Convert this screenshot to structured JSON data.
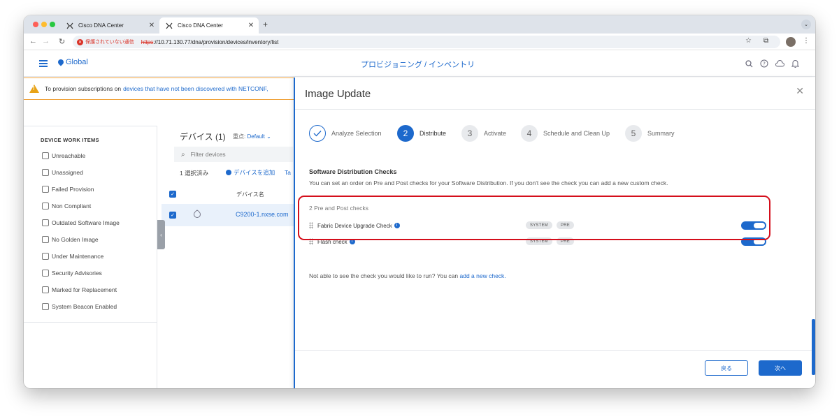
{
  "browser": {
    "tabs": [
      {
        "title": "Cisco DNA Center",
        "active": false
      },
      {
        "title": "Cisco DNA Center",
        "active": true
      }
    ],
    "new_tab": "+",
    "security_label": "保護されていない通信",
    "url_scheme": "https",
    "url_rest": "://10.71.130.77/dna/provision/devices/inventory/list"
  },
  "header": {
    "global_label": "Global",
    "title": "プロビジョニング / インベントリ"
  },
  "alert": {
    "text_before": "To provision subscriptions on",
    "link": "devices that have not been discovered with NETCONF,"
  },
  "work_items": {
    "title": "DEVICE WORK ITEMS",
    "items": [
      "Unreachable",
      "Unassigned",
      "Failed Provision",
      "Non Compliant",
      "Outdated Software Image",
      "No Golden Image",
      "Under Maintenance",
      "Security Advisories",
      "Marked for Replacement",
      "System Beacon Enabled"
    ]
  },
  "devices": {
    "title": "デバイス (1)",
    "focus_label": "重点:",
    "focus_value": "Default",
    "filter_placeholder": "Filter devices",
    "selected_text": "1 選択済み",
    "add_device": "デバイスを追加",
    "tag_truncated": "Ta",
    "column_device_name": "デバイス名",
    "row_device_name": "C9200-1.nxse.com"
  },
  "drawer": {
    "title": "Image Update",
    "steps": [
      {
        "num": "",
        "label": "Analyze Selection",
        "state": "done"
      },
      {
        "num": "2",
        "label": "Distribute",
        "state": "active"
      },
      {
        "num": "3",
        "label": "Activate",
        "state": "todo"
      },
      {
        "num": "4",
        "label": "Schedule and Clean Up",
        "state": "todo"
      },
      {
        "num": "5",
        "label": "Summary",
        "state": "todo"
      }
    ],
    "section_title": "Software Distribution Checks",
    "section_desc": "You can set an order on Pre and Post checks for your Software Distribution. If you don't see the check you can add a new custom check.",
    "checks_count": "2 Pre and Post checks",
    "checks": [
      {
        "name": "Fabric Device Upgrade Check",
        "badge1": "SYSTEM",
        "badge2": "PRE",
        "enabled": true
      },
      {
        "name": "Flash check",
        "badge1": "SYSTEM",
        "badge2": "PRE",
        "enabled": true
      }
    ],
    "not_able_text": "Not able to see the check you would like to run? You can",
    "add_check_link": "add a new check.",
    "back_button": "戻る",
    "next_button": "次へ"
  },
  "colors": {
    "accent": "#1d69cc",
    "highlight": "#d40e1b",
    "warning": "#e8a317"
  }
}
